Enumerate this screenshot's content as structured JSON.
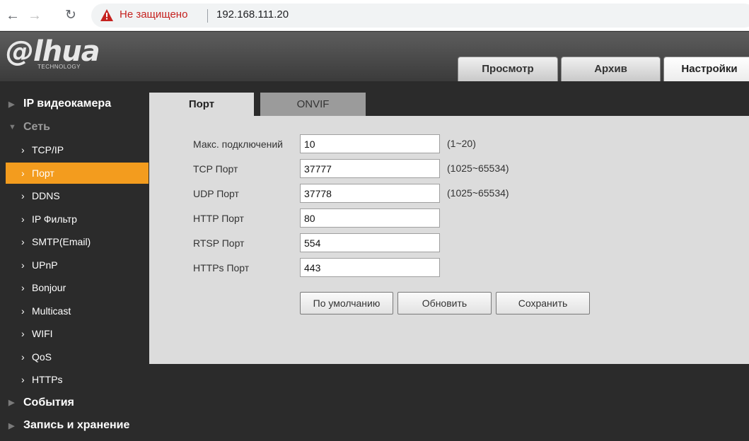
{
  "browser": {
    "security_text": "Не защищено",
    "url": "192.168.111.20",
    "icons": {
      "back": "arrow-left-icon",
      "forward": "arrow-right-icon",
      "reload": "reload-icon",
      "warning": "warning-triangle-icon"
    }
  },
  "header": {
    "logo": "alhua",
    "logo_sub": "TECHNOLOGY",
    "tabs": [
      {
        "label": "Просмотр"
      },
      {
        "label": "Архив"
      },
      {
        "label": "Настройки",
        "active": true
      }
    ]
  },
  "sidebar": {
    "items": [
      {
        "label": "IP видеокамера",
        "type": "group",
        "expanded": false
      },
      {
        "label": "Сеть",
        "type": "group",
        "expanded": true
      },
      {
        "label": "TCP/IP",
        "type": "sub"
      },
      {
        "label": "Порт",
        "type": "sub",
        "active": true
      },
      {
        "label": "DDNS",
        "type": "sub"
      },
      {
        "label": "IP Фильтр",
        "type": "sub"
      },
      {
        "label": "SMTP(Email)",
        "type": "sub"
      },
      {
        "label": "UPnP",
        "type": "sub"
      },
      {
        "label": "Bonjour",
        "type": "sub"
      },
      {
        "label": "Multicast",
        "type": "sub"
      },
      {
        "label": "WIFI",
        "type": "sub"
      },
      {
        "label": "QoS",
        "type": "sub"
      },
      {
        "label": "HTTPs",
        "type": "sub"
      },
      {
        "label": "События",
        "type": "group",
        "expanded": false
      },
      {
        "label": "Запись и хранение",
        "type": "group",
        "expanded": false
      }
    ]
  },
  "content": {
    "tabs": [
      {
        "label": "Порт",
        "active": true
      },
      {
        "label": "ONVIF"
      }
    ],
    "fields": [
      {
        "label": "Макс. подключений",
        "value": "10",
        "range": "(1~20)"
      },
      {
        "label": "TCP Порт",
        "value": "37777",
        "range": "(1025~65534)"
      },
      {
        "label": "UDP Порт",
        "value": "37778",
        "range": "(1025~65534)"
      },
      {
        "label": "HTTP Порт",
        "value": "80",
        "range": ""
      },
      {
        "label": "RTSP Порт",
        "value": "554",
        "range": ""
      },
      {
        "label": "HTTPs Порт",
        "value": "443",
        "range": ""
      }
    ],
    "buttons": {
      "default": "По умолчанию",
      "refresh": "Обновить",
      "save": "Сохранить"
    }
  },
  "colors": {
    "accent": "#f39c1e",
    "sidebar_bg": "#2b2b2b",
    "panel_bg": "#dcdcdc",
    "security_warning": "#c5221f"
  }
}
